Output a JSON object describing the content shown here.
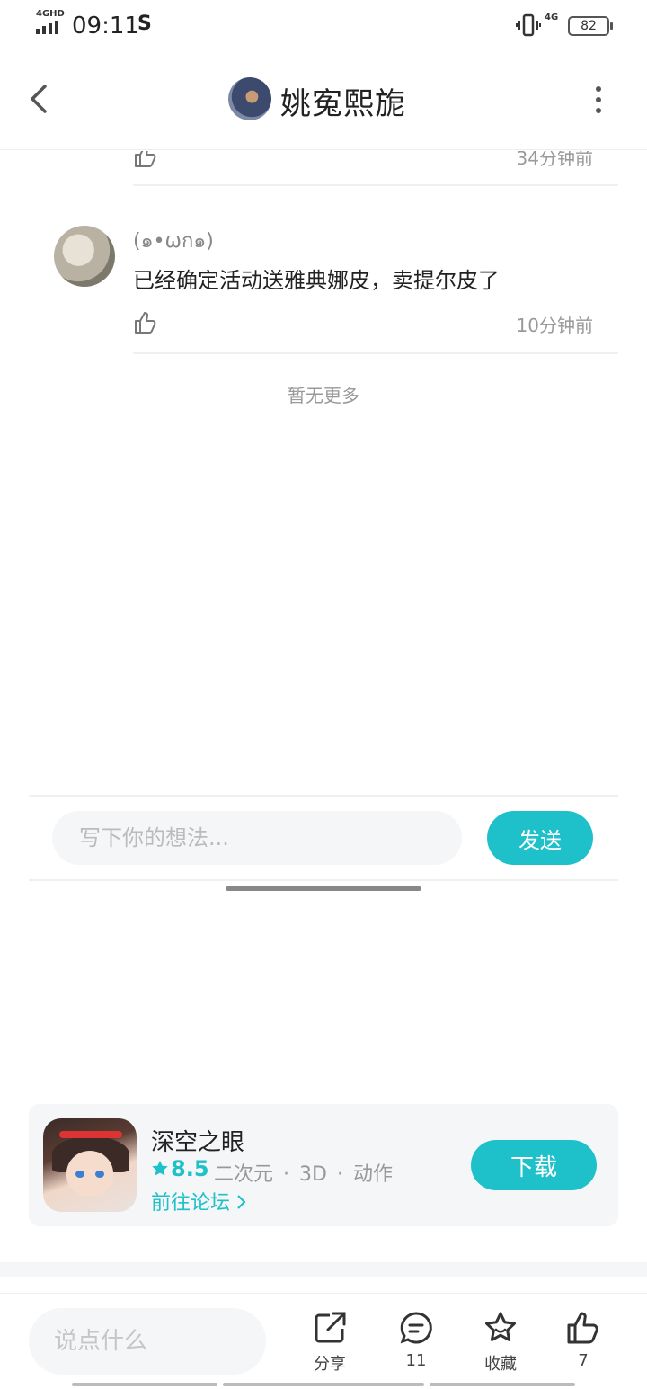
{
  "status_bar": {
    "network_top": "4GHD",
    "time": "09:11",
    "net": "4G",
    "battery": "82"
  },
  "header": {
    "title": "姚寃熙旎"
  },
  "comments": [
    {
      "time": "34分钟前"
    },
    {
      "user": "(๑•ωก๑)",
      "text": "已经确定活动送雅典娜皮，卖提尔皮了",
      "time": "10分钟前"
    }
  ],
  "no_more": "暂无更多",
  "reply": {
    "placeholder": "写下你的想法...",
    "send": "发送"
  },
  "game": {
    "name": "深空之眼",
    "rating": "8.5",
    "tags": [
      "二次元",
      "·",
      "3D",
      "·",
      "动作"
    ],
    "forum_link": "前往论坛",
    "download": "下载"
  },
  "bottom_bar": {
    "placeholder": "说点什么",
    "share": "分享",
    "comments_count": "11",
    "favorite": "收藏",
    "likes_count": "7"
  },
  "colors": {
    "accent": "#1ec0c9"
  }
}
